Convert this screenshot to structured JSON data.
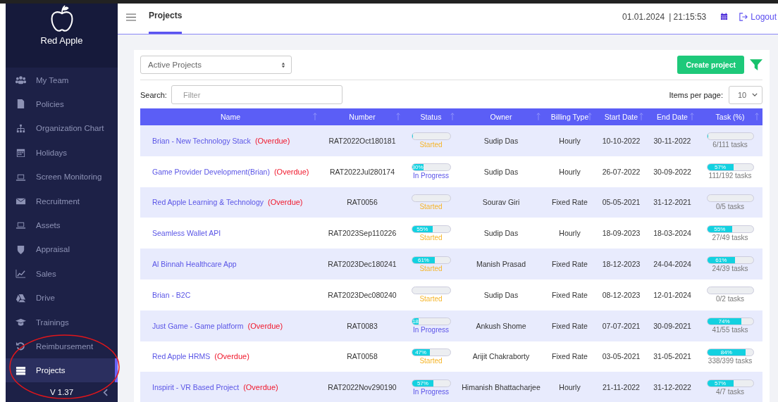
{
  "sidebar": {
    "brand": "Red Apple",
    "items": [
      {
        "label": "My Team",
        "selected": false
      },
      {
        "label": "Policies",
        "selected": false
      },
      {
        "label": "Organization Chart",
        "selected": false
      },
      {
        "label": "Holidays",
        "selected": false
      },
      {
        "label": "Screen Monitoring",
        "selected": false
      },
      {
        "label": "Recruitment",
        "selected": false
      },
      {
        "label": "Assets",
        "selected": false
      },
      {
        "label": "Appraisal",
        "selected": false
      },
      {
        "label": "Sales",
        "selected": false
      },
      {
        "label": "Drive",
        "selected": false
      },
      {
        "label": "Trainings",
        "selected": false
      },
      {
        "label": "Reimbursement",
        "selected": false
      },
      {
        "label": "Projects",
        "selected": true
      }
    ],
    "version": "V 1.37"
  },
  "header": {
    "tabs": [
      {
        "label": "Projects",
        "selected": true
      }
    ],
    "date": "01.01.2024",
    "time": "| 21:15:53",
    "logout": "Logout"
  },
  "toolbar": {
    "project_filter": "Active Projects",
    "create_button": "Create project",
    "search_label": "Search:",
    "search_placeholder": "Filter",
    "items_per_page_label": "Items per page:",
    "items_per_page": "10"
  },
  "table": {
    "columns": [
      "Name",
      "Number",
      "Status",
      "Owner",
      "Billing Type",
      "Start Date",
      "End Date",
      "Task (%)"
    ],
    "rows": [
      {
        "name": "Brian - New Technology Stack",
        "overdue": "(Overdue)",
        "number": "RAT2022Oct180181",
        "status": {
          "level": 0.02,
          "text": "Started",
          "kind": "started"
        },
        "owner": "Sudip Das",
        "billing": "Hourly",
        "start": "10-10-2022",
        "end": "30-11-2022",
        "task": {
          "level": 0.03,
          "text": "6/111 tasks"
        }
      },
      {
        "name": "Game Provider Development(Brian)",
        "overdue": "(Overdue)",
        "number": "RAT2022Jul280174",
        "status": {
          "level": 0.3,
          "bar_label": "30%",
          "text": "In Progress",
          "kind": "progress"
        },
        "owner": "Sudip Das",
        "billing": "Hourly",
        "start": "26-07-2022",
        "end": "30-09-2022",
        "task": {
          "level": 0.57,
          "bar_label": "57%",
          "text": "111/192 tasks"
        }
      },
      {
        "name": "Red Apple Learning & Technology",
        "overdue": "(Overdue)",
        "number": "RAT0056",
        "status": {
          "level": 0,
          "text": "Started",
          "kind": "started"
        },
        "owner": "Sourav Giri",
        "billing": "Fixed Rate",
        "start": "05-05-2021",
        "end": "31-12-2021",
        "task": {
          "level": 0,
          "text": "0/5 tasks"
        }
      },
      {
        "name": "Seamless Wallet API",
        "number": "RAT2023Sep110226",
        "status": {
          "level": 0.55,
          "bar_label": "55%",
          "text": "Started",
          "kind": "started"
        },
        "owner": "Sudip Das",
        "billing": "Hourly",
        "start": "18-09-2023",
        "end": "18-03-2024",
        "task": {
          "level": 0.55,
          "bar_label": "55%",
          "text": "27/49 tasks"
        }
      },
      {
        "name": "Al Binnah Healthcare App",
        "number": "RAT2023Dec180241",
        "status": {
          "level": 0.61,
          "bar_label": "61%",
          "text": "Started",
          "kind": "started"
        },
        "owner": "Manish Prasad",
        "billing": "Fixed Rate",
        "start": "18-12-2023",
        "end": "24-04-2024",
        "task": {
          "level": 0.61,
          "bar_label": "61%",
          "text": "24/39 tasks"
        }
      },
      {
        "name": "Brian - B2C",
        "number": "RAT2023Dec080240",
        "status": {
          "level": 0,
          "text": "Started",
          "kind": "started"
        },
        "owner": "Sudip Das",
        "billing": "Fixed Rate",
        "start": "08-12-2023",
        "end": "12-01-2024",
        "task": {
          "level": 0,
          "text": "0/2 tasks"
        }
      },
      {
        "name": "Just Game - Game platform",
        "overdue": "(Overdue)",
        "number": "RAT0083",
        "status": {
          "level": 0.18,
          "bar_label": "18",
          "text": "In Progress",
          "kind": "progress"
        },
        "owner": "Ankush Shome",
        "billing": "Fixed Rate",
        "start": "07-07-2021",
        "end": "30-09-2021",
        "task": {
          "level": 0.74,
          "bar_label": "74%",
          "text": "41/55 tasks"
        }
      },
      {
        "name": "Red Apple HRMS",
        "overdue": "(Overdue)",
        "number": "RAT0058",
        "status": {
          "level": 0.47,
          "bar_label": "47%",
          "text": "Started",
          "kind": "started"
        },
        "owner": "Arijit Chakraborty",
        "billing": "Fixed Rate",
        "start": "03-05-2021",
        "end": "31-05-2021",
        "task": {
          "level": 0.84,
          "bar_label": "84%",
          "text": "338/399 tasks"
        }
      },
      {
        "name": "Inspirit - VR Based Project",
        "overdue": "(Overdue)",
        "number": "RAT2022Nov290190",
        "status": {
          "level": 0.57,
          "bar_label": "57%",
          "text": "In Progress",
          "kind": "progress"
        },
        "owner": "Himanish Bhattacharjee",
        "billing": "Hourly",
        "start": "21-11-2022",
        "end": "31-12-2022",
        "task": {
          "level": 0.57,
          "bar_label": "57%",
          "text": "4/7 tasks"
        }
      }
    ]
  }
}
